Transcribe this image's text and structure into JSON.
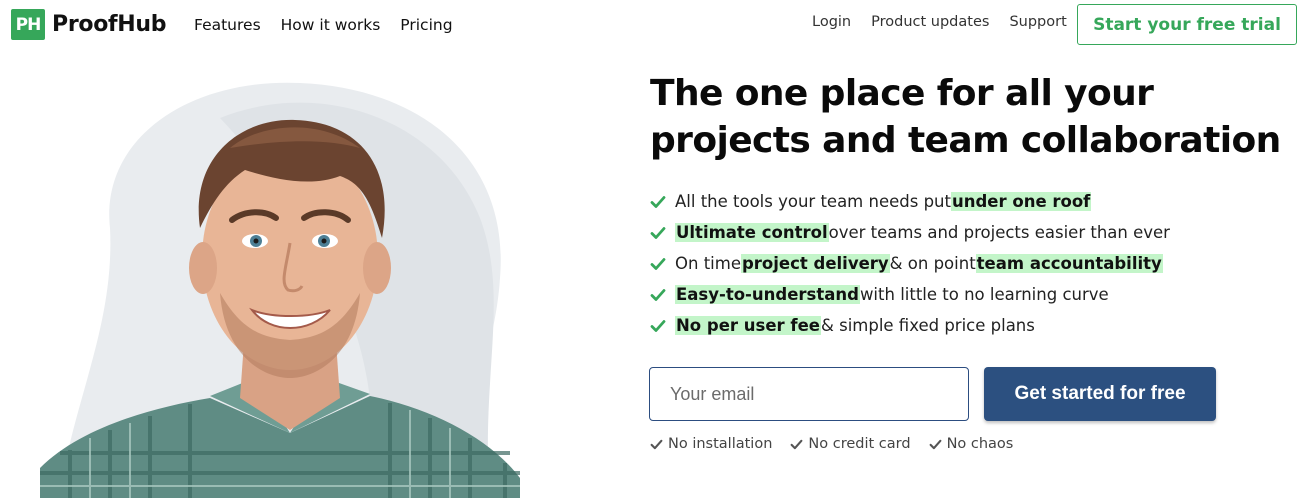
{
  "brand": {
    "logo_mark": "PH",
    "name": "ProofHub",
    "color": "#36a75a"
  },
  "nav": {
    "left": [
      {
        "label": "Features"
      },
      {
        "label": "How it works"
      },
      {
        "label": "Pricing"
      }
    ],
    "right": [
      {
        "label": "Login"
      },
      {
        "label": "Product updates"
      },
      {
        "label": "Support"
      }
    ],
    "trial_button": "Start your free trial"
  },
  "hero": {
    "headline": "The one place for all your projects and team collaboration",
    "features": [
      [
        {
          "t": "All the tools your team needs put ",
          "h": false
        },
        {
          "t": "under one roof",
          "h": true
        }
      ],
      [
        {
          "t": "Ultimate control",
          "h": true
        },
        {
          "t": " over teams and projects easier than ever",
          "h": false
        }
      ],
      [
        {
          "t": "On time ",
          "h": false
        },
        {
          "t": "project delivery",
          "h": true
        },
        {
          "t": " & on point ",
          "h": false
        },
        {
          "t": "team accountability",
          "h": true
        }
      ],
      [
        {
          "t": "Easy-to-understand",
          "h": true
        },
        {
          "t": " with little to no learning curve",
          "h": false
        }
      ],
      [
        {
          "t": "No per user fee",
          "h": true
        },
        {
          "t": " & simple fixed price plans",
          "h": false
        }
      ]
    ],
    "email_placeholder": "Your email",
    "cta_button": "Get started for free",
    "assurances": [
      "No installation",
      "No credit card",
      "No chaos"
    ],
    "highlight_color": "#c3f5c9",
    "cta_color": "#2c5080",
    "check_color": "#36a75a"
  }
}
